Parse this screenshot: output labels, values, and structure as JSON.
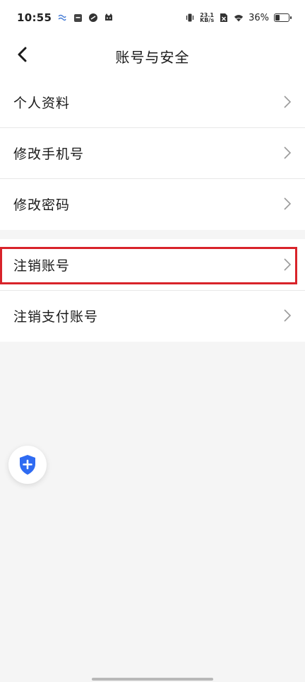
{
  "status_bar": {
    "time": "10:55",
    "net_speed_value": "23.1",
    "net_speed_unit": "KB/s",
    "battery_percent": "36%",
    "battery_level": 0.36
  },
  "header": {
    "title": "账号与安全"
  },
  "groups": [
    {
      "items": [
        {
          "label": "个人资料"
        },
        {
          "label": "修改手机号"
        },
        {
          "label": "修改密码"
        }
      ]
    },
    {
      "items": [
        {
          "label": "注销账号",
          "highlighted": true
        },
        {
          "label": "注销支付账号"
        }
      ]
    }
  ],
  "colors": {
    "highlight_border": "#d8232a",
    "shield_blue": "#2f6bf2",
    "background": "#f5f5f5"
  },
  "icons": {
    "back": "chevron-left-icon",
    "row_arrow": "chevron-right-icon",
    "fab": "shield-plus-icon"
  }
}
